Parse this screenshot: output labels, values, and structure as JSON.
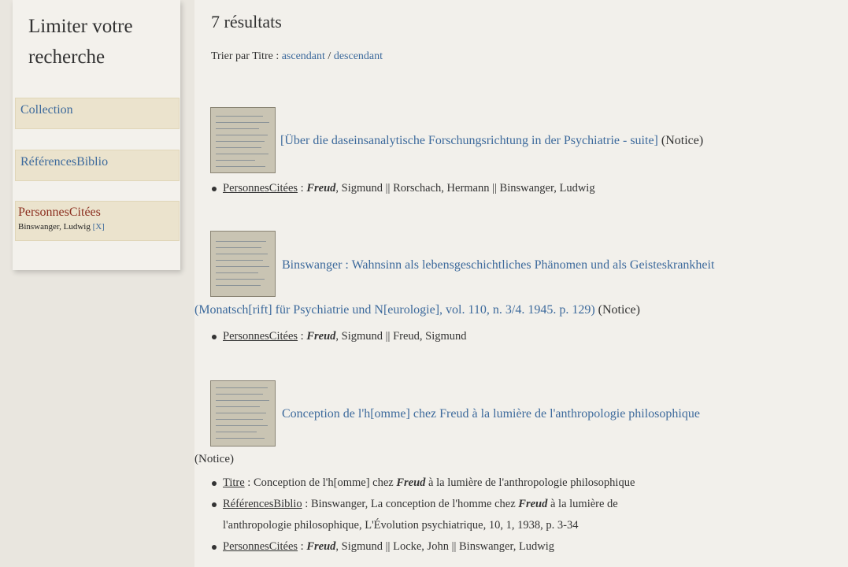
{
  "sidebar": {
    "title": "Limiter votre recherche",
    "facets": [
      {
        "label": "Collection"
      },
      {
        "label": "RéférencesBiblio"
      },
      {
        "label": "PersonnesCitées",
        "selected_value": "Binswanger, Ludwig",
        "remove_label": "[X]"
      }
    ]
  },
  "main": {
    "results_count": "7 résultats",
    "sort": {
      "prefix": "Trier par Titre : ",
      "asc": "ascendant",
      "sep": " / ",
      "desc": "descendant"
    },
    "results": [
      {
        "title": "[Über die daseinsanalytische Forschungsrichtung in der Psychiatrie - suite]",
        "type": "(Notice)",
        "fields": [
          {
            "key": "PersonnesCitées",
            "sep": " : ",
            "freud": "Freud",
            "value": ", Sigmund || Rorschach, Hermann || Binswanger, Ludwig"
          }
        ]
      },
      {
        "title_line1": "Binswanger : Wahnsinn als lebensgeschichtliches Phänomen und als Geisteskrankheit",
        "title_line2": "(Monatsch[rift] für Psychiatrie und N[eurologie], vol. 110, n. 3/4. 1945. p. 129)",
        "type": "(Notice)",
        "fields": [
          {
            "key": "PersonnesCitées",
            "sep": " : ",
            "freud": "Freud",
            "value": ", Sigmund || Freud, Sigmund"
          }
        ]
      },
      {
        "title": "Conception de l'h[omme] chez Freud à la lumière de l'anthropologie philosophique",
        "type": "(Notice)",
        "fields": [
          {
            "key": "Titre",
            "sep": " : ",
            "before": "Conception de l'h[omme] chez ",
            "freud": "Freud",
            "after": " à la lumière de l'anthropologie philosophique"
          },
          {
            "key": "RéférencesBiblio",
            "sep": " : ",
            "before": "Binswanger, La conception de l'homme chez ",
            "freud": "Freud",
            "after": " à la lumière de",
            "line2": "l'anthropologie philosophique, L'Évolution psychiatrique, 10, 1, 1938, p. 3-34"
          },
          {
            "key": "PersonnesCitées",
            "sep": " : ",
            "freud": "Freud",
            "value": ", Sigmund || Locke, John || Binswanger, Ludwig"
          }
        ]
      }
    ]
  }
}
